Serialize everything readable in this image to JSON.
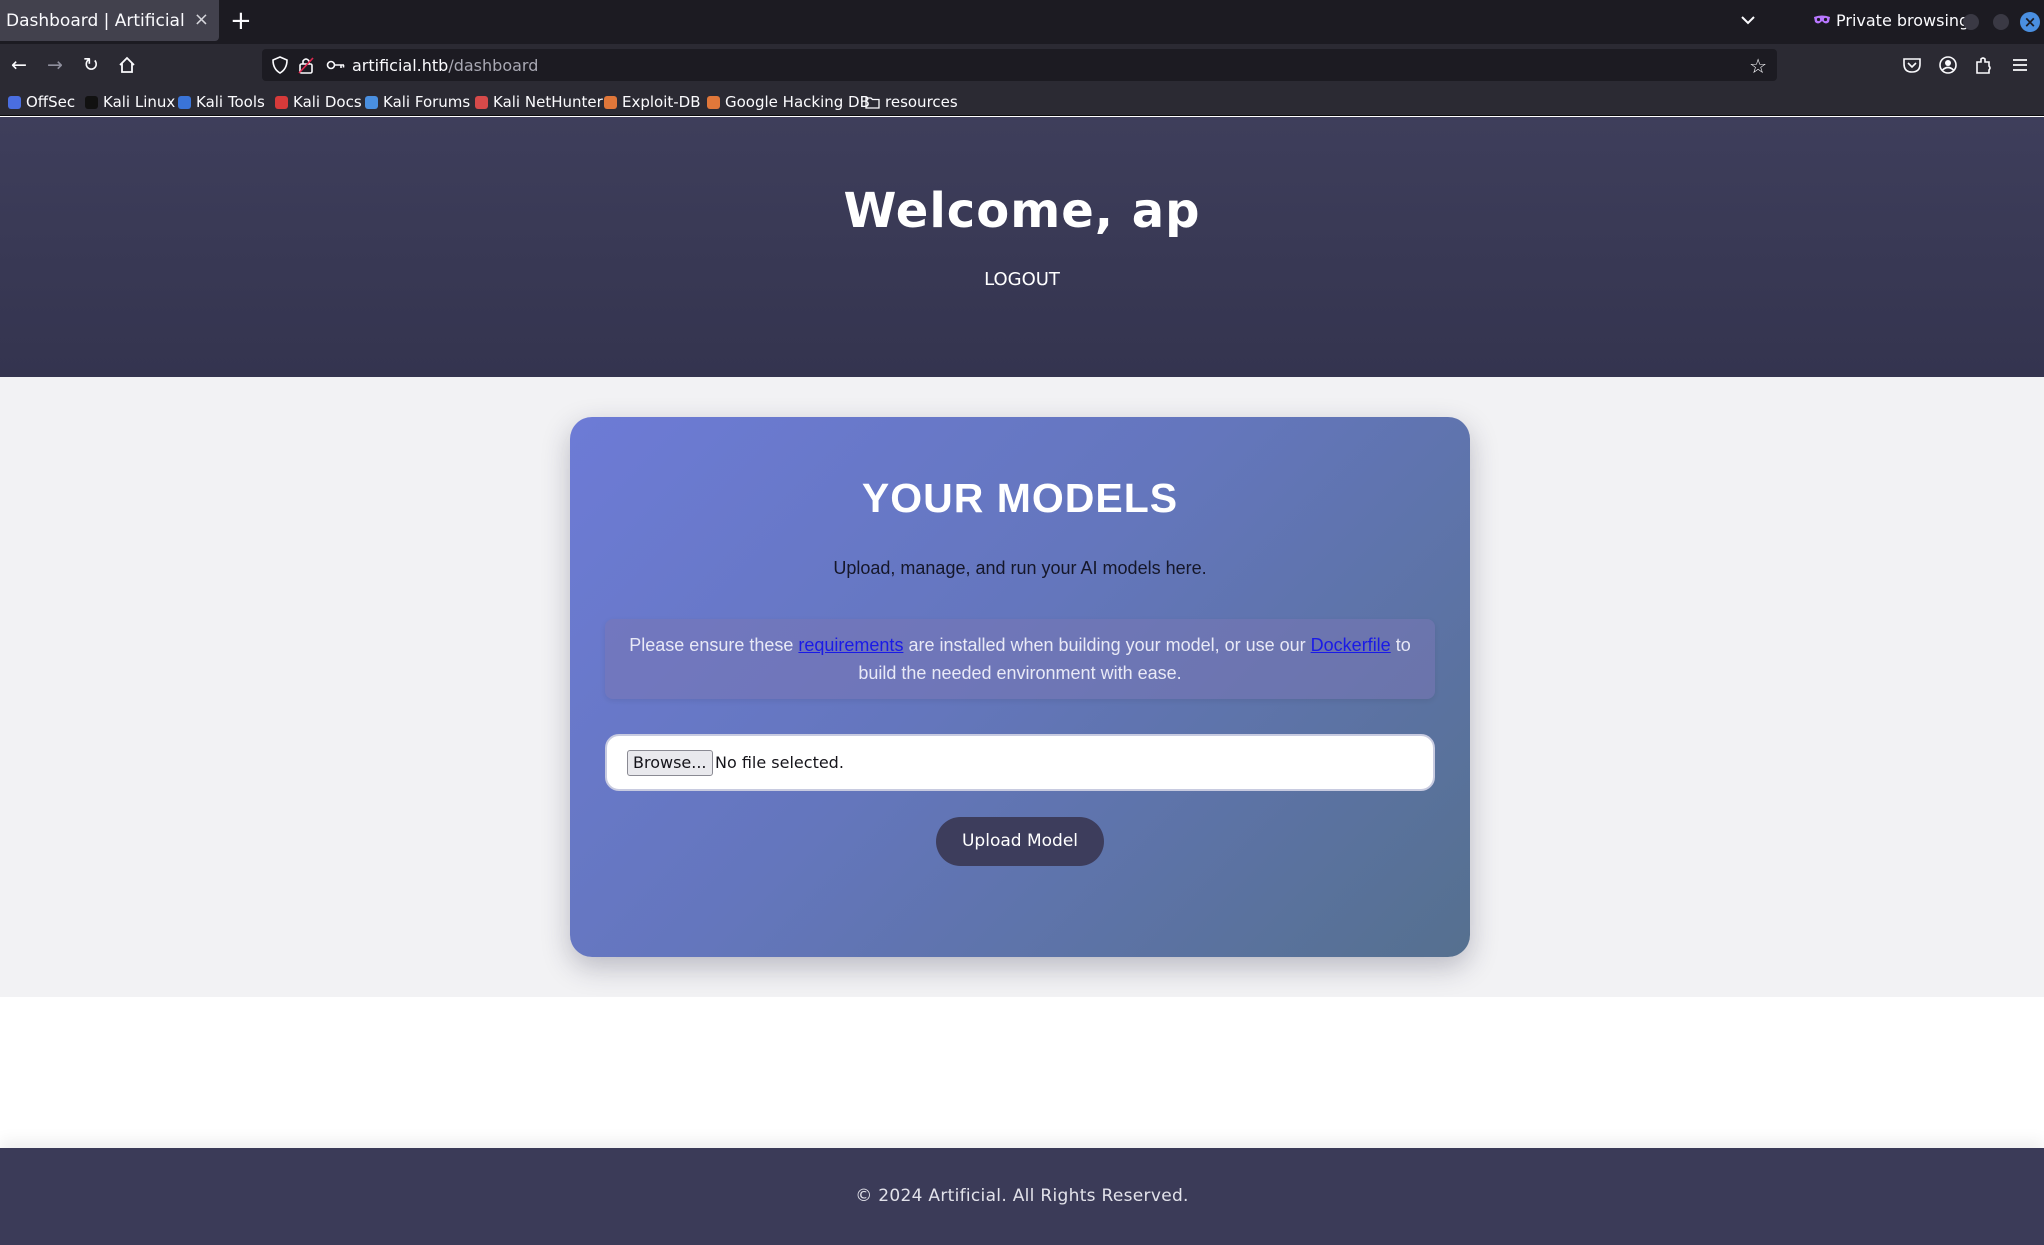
{
  "browser": {
    "tab_title": "Dashboard | Artificial",
    "tab_close": "×",
    "new_tab": "+",
    "private_label": "Private browsing",
    "url_host": "artificial.htb",
    "url_path": "/dashboard",
    "bookmarks": [
      {
        "label": "OffSec",
        "color": "#4a6ee0"
      },
      {
        "label": "Kali Linux",
        "color": "#1e1e1e"
      },
      {
        "label": "Kali Tools",
        "color": "#3a74d8"
      },
      {
        "label": "Kali Docs",
        "color": "#d63a3a"
      },
      {
        "label": "Kali Forums",
        "color": "#4a8fe0"
      },
      {
        "label": "Kali NetHunter",
        "color": "#d64a4a"
      },
      {
        "label": "Exploit-DB",
        "color": "#e0773a"
      },
      {
        "label": "Google Hacking DB",
        "color": "#e0773a"
      },
      {
        "label": "resources",
        "color": "folder"
      }
    ]
  },
  "header": {
    "welcome": "Welcome, ap",
    "logout": "LOGOUT"
  },
  "card": {
    "title": "YOUR MODELS",
    "subtitle": "Upload, manage, and run your AI models here.",
    "notice_part1": "Please ensure these ",
    "notice_link1": "requirements",
    "notice_part2": " are installed when building your model, or use our ",
    "notice_link2": "Dockerfile",
    "notice_part3": " to build the needed environment with ease.",
    "browse_label": "Browse...",
    "file_status": "No file selected.",
    "upload_label": "Upload Model"
  },
  "footer": {
    "text": "© 2024 Artificial. All Rights Reserved."
  },
  "colors": {
    "hero": "#3a3a56",
    "card_start": "#6d7bd6",
    "card_end": "#55708f",
    "upload_button": "#3d3d5c",
    "footer": "#3b3b58",
    "link": "#1a1ae6"
  }
}
